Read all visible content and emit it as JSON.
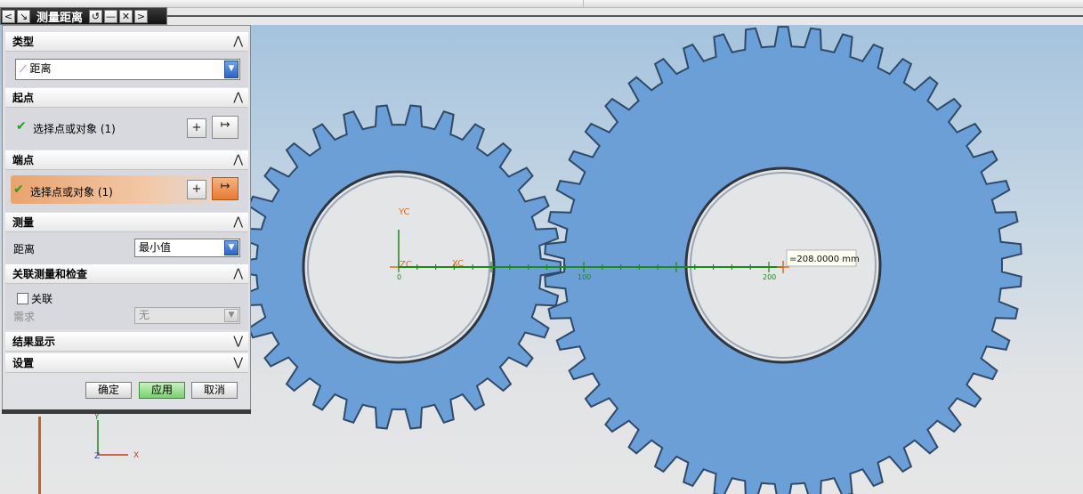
{
  "window": {
    "title": "测量距离",
    "buttons": {
      "back": "<",
      "reset": "↺",
      "minimize": "—",
      "close": "✕",
      "forward": ">"
    }
  },
  "sections": {
    "type": {
      "title": "类型",
      "value": "距离",
      "chevron": "⋀"
    },
    "start": {
      "title": "起点",
      "select_label": "选择点或对象 (1)",
      "chevron": "⋀"
    },
    "end": {
      "title": "端点",
      "select_label": "选择点或对象 (1)",
      "chevron": "⋀"
    },
    "measure": {
      "title": "测量",
      "distance_label": "距离",
      "distance_value": "最小值",
      "chevron": "⋀"
    },
    "assoc": {
      "title": "关联测量和检查",
      "checkbox_label": "关联",
      "req_label": "需求",
      "req_value": "无",
      "chevron": "⋀"
    },
    "result": {
      "title": "结果显示",
      "chevron": "⋁"
    },
    "settings": {
      "title": "设置",
      "chevron": "⋁"
    }
  },
  "buttons": {
    "ok": "确定",
    "apply": "应用",
    "cancel": "取消"
  },
  "viewport": {
    "wcs": {
      "yc": "YC",
      "xc": "XC",
      "zc": "ZC"
    },
    "ruler_ticks": [
      "0",
      "100",
      "200"
    ],
    "measurement": "=208.0000 mm",
    "triad": {
      "x": "X",
      "y": "Y",
      "z": "Z"
    }
  },
  "colors": {
    "gear_fill": "#6a9fd8",
    "gear_edge": "#2f4a68",
    "ruler": "#1a8a1a",
    "accent_orange": "#e06a22",
    "dialog_bg": "#dfe1e5"
  }
}
